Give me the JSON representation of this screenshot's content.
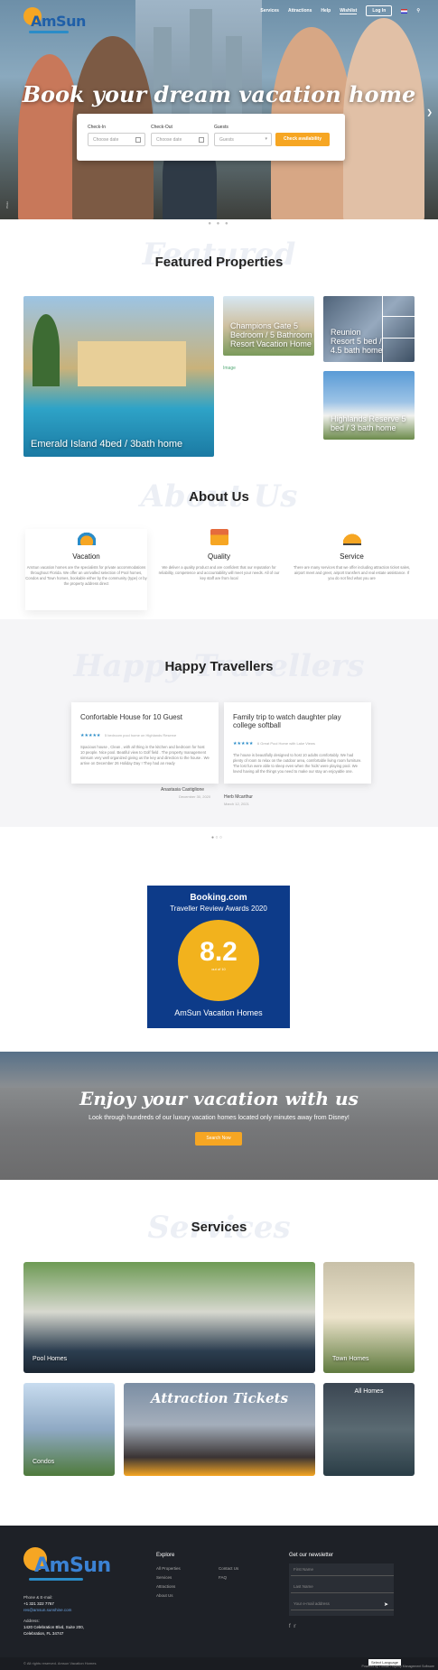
{
  "header": {
    "logo_text": "AmSun",
    "nav": [
      "Services",
      "Attractions",
      "Help",
      "Wishlist",
      "Log In"
    ],
    "hero_title": "Book your dream vacation home",
    "credit": "Photo"
  },
  "search": {
    "checkin_label": "Check-In",
    "checkin_placeholder": "Choose date",
    "checkout_label": "Check-Out",
    "checkout_placeholder": "Choose date",
    "guests_label": "Guests",
    "guests_value": "Guests",
    "button": "Check availability"
  },
  "featured": {
    "ghost": "Featured",
    "title": "Featured Properties",
    "cards": [
      {
        "title": "Emerald Island 4bed / 3bath home",
        "color": "#3a8cb0"
      },
      {
        "title": "Champions Gate 5 Bedroom / 5 Bathroom Resort Vacation Home",
        "color": "#b8c7a0"
      },
      {
        "title": "Reunion Resort 5 bed / 4.5 bath home",
        "color": "#5d7186"
      },
      {
        "title": "Highlands Reserve 5 bed / 3 bath home",
        "color": "#6ea6d4"
      }
    ],
    "broken_image": "Image"
  },
  "about": {
    "ghost": "About Us",
    "title": "About Us",
    "cols": [
      {
        "title": "Vacation",
        "text": "AmSun vacation homes are the specialists for private accommodations throughout Florida. We offer an unrivalled selection of Pool homes, Condos and Town homes, bookable either by the community (type) or by the property address direct"
      },
      {
        "title": "Quality",
        "text": "We deliver a quality product and are confident that our reputation for reliability, competence and accountability will meet your needs. All of our key staff are from local"
      },
      {
        "title": "Service",
        "text": "There are many services that we offer including attraction ticket sales, airport meet and greet, airport transfers and real estate assistance. If you do not find what you are"
      }
    ]
  },
  "travellers": {
    "ghost": "Happy Travellers",
    "title": "Happy Travellers",
    "reviews": [
      {
        "title": "Confortable House for 10 Guest",
        "stars": "★★★★★",
        "meta": "5 bedroom pool home on Highlands Reserve",
        "body": "Spacious house , Clean , with all thing in the kitchen and bedroom for host 10 people. Nice pool. Beatiful view to Golf field . The property management simsum very well organized giving us the key and direction to the house . We arrive on December 26 Holiday Day ! They had an ready",
        "author": "Anastasia Castiglione",
        "date": "December 30, 2020"
      },
      {
        "title": "Family trip to watch daughter play college softball",
        "stars": "★★★★★",
        "meta": "6 Great Pool Home with Lake Views",
        "body": "The house is beautifully designed to host 10 adults comfortably. We had plenty of room to relax on the outdoor area, comfortable living room furniture. The lost fun were able to sleep even when the 'kids' were playing pool. We loved having all the things you need to make our stay an enjoyable one.",
        "author": "Herb Mcarthur",
        "date": "March 12, 2021"
      }
    ]
  },
  "booking": {
    "brand": "Booking.com",
    "award": "Traveller Review Awards 2020",
    "score": "8.2",
    "out_of": "out of 10",
    "name": "AmSun Vacation Homes"
  },
  "enjoy": {
    "title": "Enjoy your vacation with us",
    "subtitle": "Look through hundreds of our luxury vacation homes located only minutes away from Disney!",
    "button": "Search Now"
  },
  "services": {
    "ghost": "Services",
    "title": "Services",
    "items": [
      {
        "title": "Pool Homes",
        "color": "#3f6f3a"
      },
      {
        "title": "Town Homes",
        "color": "#b9a88c"
      },
      {
        "title": "Condos",
        "color": "#5f8ab0"
      },
      {
        "title": "Attraction Tickets",
        "color": "#6a7d92"
      },
      {
        "title": "All Homes",
        "color": "#2b3540"
      }
    ]
  },
  "footer": {
    "logo_text": "AmSun",
    "phone_label": "Phone & E-mail:",
    "phone": "+1 321 322 7767",
    "email": "res@amsun.sunshine.com",
    "address_label": "Address:",
    "address_1": "1420 Celebration Blvd, Suite 200,",
    "address_2": "Celebration, FL 34747",
    "explore_title": "Explore",
    "explore_col1": [
      "All Properties",
      "Services",
      "Attractions",
      "About Us"
    ],
    "explore_col2": [
      "Contact Us",
      "FAQ"
    ],
    "newsletter_title": "Get our newsletter",
    "first_name": "First Name",
    "last_name": "Last Name",
    "email_placeholder": "Your e-mail address",
    "copyright": "© All rights reserved. Amsun Vacation Homes",
    "select_language": "Select Language",
    "powered": "Powered by Florida Property Management Software"
  }
}
